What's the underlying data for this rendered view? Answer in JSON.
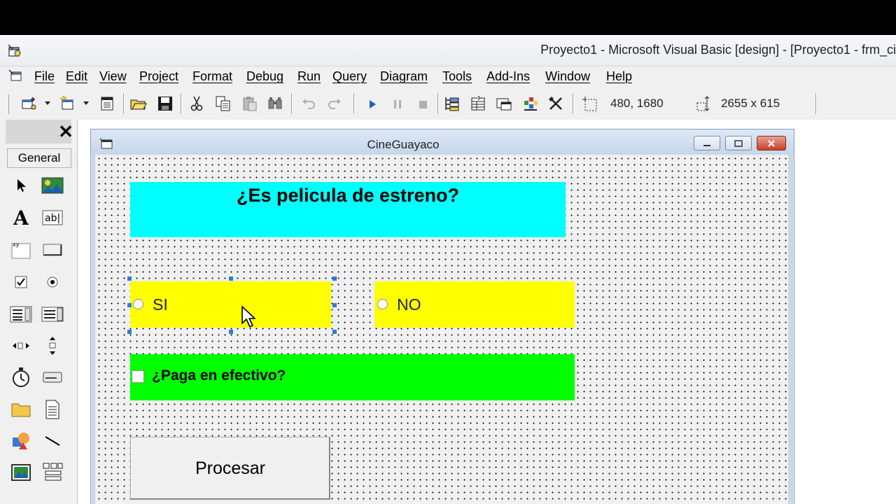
{
  "app": {
    "title": "Proyecto1 - Microsoft Visual Basic [design] - [Proyecto1 - frm_ci"
  },
  "menu": {
    "items": [
      "File",
      "Edit",
      "View",
      "Project",
      "Format",
      "Debug",
      "Run",
      "Query",
      "Diagram",
      "Tools",
      "Add-Ins",
      "Window",
      "Help"
    ]
  },
  "toolbar": {
    "position": "480, 1680",
    "size": "2655 x 615",
    "icons": [
      "add-project-icon",
      "add-form-icon",
      "menu-editor-icon",
      "open-icon",
      "save-icon",
      "cut-icon",
      "copy-icon",
      "paste-icon",
      "find-icon",
      "undo-icon",
      "redo-icon",
      "start-icon",
      "break-icon",
      "end-icon",
      "project-explorer-icon",
      "properties-window-icon",
      "form-layout-icon",
      "object-browser-icon",
      "toolbox-icon",
      "position-icon",
      "size-icon"
    ]
  },
  "toolbox": {
    "close": "✕",
    "tab": "General",
    "tools": [
      "pointer",
      "picturebox",
      "label",
      "textbox",
      "frame",
      "commandbutton",
      "checkbox",
      "optionbutton",
      "combobox",
      "listbox",
      "hscrollbar",
      "vscrollbar",
      "timer",
      "drivelistbox",
      "dirlistbox",
      "filelistbox",
      "shape",
      "line",
      "image",
      "data"
    ]
  },
  "form": {
    "title": "CineGuayaco",
    "label_estreno": "¿Es pelicula de estreno?",
    "option_si": "SI",
    "option_no": "NO",
    "checkbox_efectivo": "¿Paga en efectivo?",
    "button_procesar": "Procesar",
    "colors": {
      "label_bg": "#00ffff",
      "option_bg": "#ffff00",
      "checkbox_bg": "#00ff00"
    }
  }
}
